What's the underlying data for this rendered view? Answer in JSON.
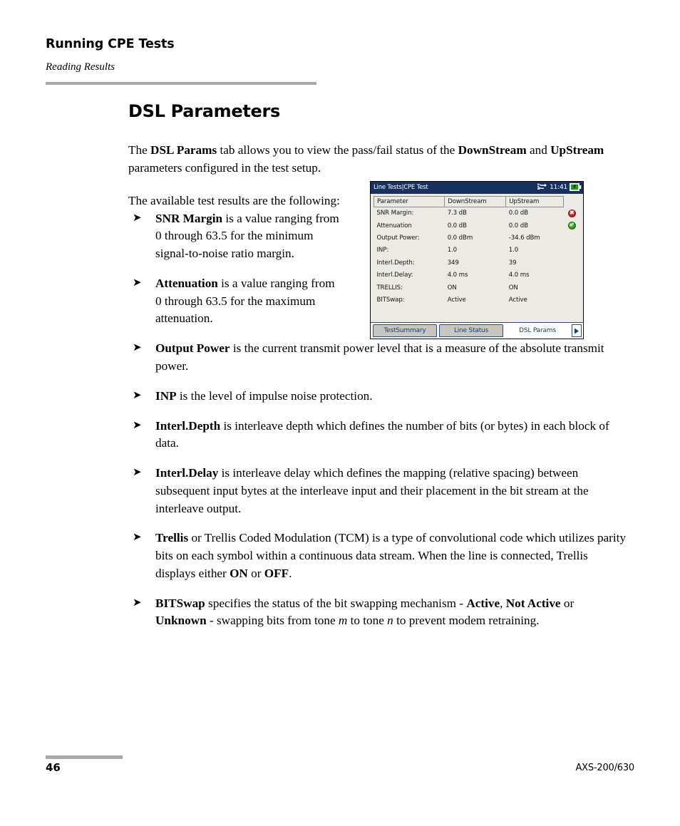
{
  "header": {
    "chapter_title": "Running CPE Tests",
    "section_subtitle": "Reading Results"
  },
  "section": {
    "title": "DSL Parameters",
    "intro_paragraph_html": "The <b>DSL Params</b> tab allows you to view the pass/fail status of the <b>DownStream</b> and <b>UpStream</b> parameters configured in the test setup.",
    "lead_in_text": "The available test results are the following:"
  },
  "bullets": [
    {
      "html": "<b>SNR Margin</b> is a value ranging from 0 through 63.5 for the minimum signal-to-noise ratio margin.",
      "narrow": true
    },
    {
      "html": "<b>Attenuation</b> is a value ranging from 0 through 63.5 for the maximum attenuation.",
      "narrow": true
    },
    {
      "html": "<b>Output Power</b> is the current transmit power level that is a measure of the absolute transmit power.",
      "narrow": false
    },
    {
      "html": "<b>INP</b> is the level of impulse noise protection.",
      "narrow": false
    },
    {
      "html": "<b>Interl.Depth</b> is interleave depth which defines the number of bits (or bytes) in each block of data.",
      "narrow": false
    },
    {
      "html": "<b>Interl.Delay</b> is interleave delay which defines the mapping (relative spacing) between subsequent input bytes at the interleave input and their placement in the bit stream at the interleave output.",
      "narrow": false
    },
    {
      "html": "<b>Trellis</b> or Trellis Coded Modulation (TCM) is a type of convolutional code which utilizes parity bits on each symbol within a continuous data stream. When the line is connected, Trellis displays either <b>ON</b> or <b>OFF</b>.",
      "narrow": false
    },
    {
      "html": "<b>BITSwap</b> specifies the status of the bit swapping mechanism - <b>Active</b>, <b>Not Active</b> or <b>Unknown</b> - swapping bits from tone <i>m</i> to tone <i>n</i> to prevent modem retraining.",
      "narrow": false
    }
  ],
  "device": {
    "titlebar": {
      "breadcrumb": "Line Tests|CPE Test",
      "clock": "11:41",
      "network_icon": "network-icon",
      "battery_icon": "battery-icon",
      "background_color": "#17305f"
    },
    "table": {
      "headers": [
        "Parameter",
        "DownStream",
        "UpStream",
        ""
      ],
      "rows": [
        {
          "parameter": "SNR Margin:",
          "downstream": "7.3 dB",
          "upstream": "0.0 dB",
          "status": "fail"
        },
        {
          "parameter": "Attenuation",
          "downstream": "0.0 dB",
          "upstream": "0.0 dB",
          "status": "pass"
        },
        {
          "parameter": "Output Power:",
          "downstream": "0.0 dBm",
          "upstream": "-34.6 dBm",
          "status": ""
        },
        {
          "parameter": "INP:",
          "downstream": "1.0",
          "upstream": "1.0",
          "status": ""
        },
        {
          "parameter": "Interl.Depth:",
          "downstream": "349",
          "upstream": "39",
          "status": ""
        },
        {
          "parameter": "Interl.Delay:",
          "downstream": "4.0 ms",
          "upstream": "4.0 ms",
          "status": ""
        },
        {
          "parameter": "TRELLIS:",
          "downstream": "ON",
          "upstream": "ON",
          "status": ""
        },
        {
          "parameter": "BITSwap:",
          "downstream": "Active",
          "upstream": "Active",
          "status": ""
        }
      ],
      "status_fail_color": "#b81414",
      "status_pass_color": "#169316"
    },
    "tabs": [
      {
        "label": "TestSummary",
        "active": false
      },
      {
        "label": "Line Status",
        "active": false
      },
      {
        "label": "DSL Params",
        "active": true
      }
    ],
    "tab_next_arrow": "chevron-right-icon"
  },
  "footer": {
    "page_number": "46",
    "model": "AXS-200/630"
  }
}
